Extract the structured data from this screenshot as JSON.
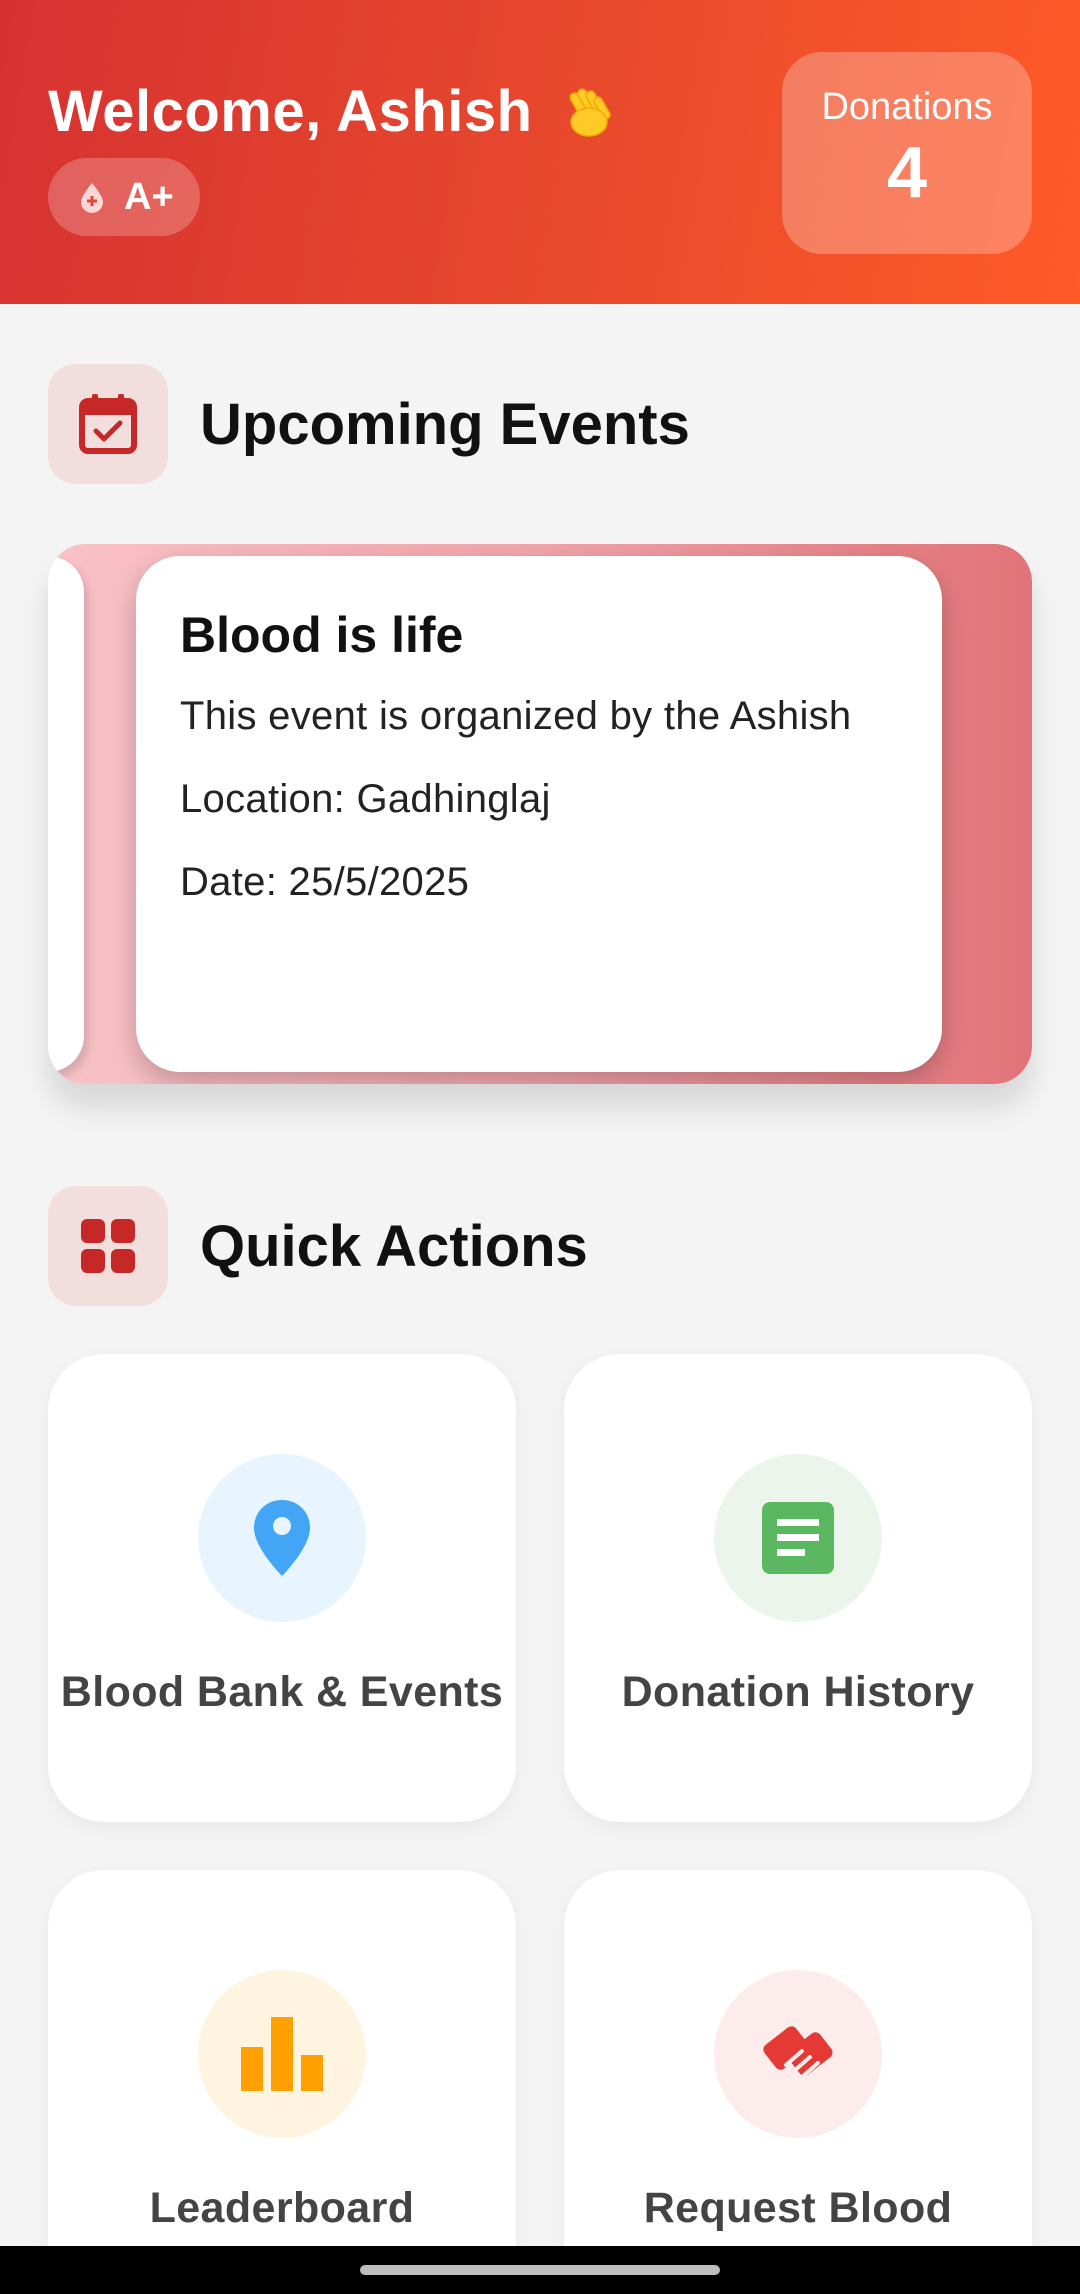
{
  "header": {
    "welcome_text": "Welcome, Ashish",
    "wave_icon": "waving-hand-icon",
    "blood_group": "A+",
    "donations_label": "Donations",
    "donations_count": "4"
  },
  "events_section": {
    "title": "Upcoming Events",
    "icon": "calendar-check-icon"
  },
  "event": {
    "title": "Blood is life",
    "description": "This event is organized by the Ashish",
    "location": "Location: Gadhinglaj",
    "date": "Date: 25/5/2025"
  },
  "actions_section": {
    "title": "Quick Actions",
    "icon": "grid-icon"
  },
  "actions": [
    {
      "label": "Blood Bank & Events",
      "icon": "location-pin-icon",
      "color": "#42a5f5",
      "bg": "#e8f4fe"
    },
    {
      "label": "Donation History",
      "icon": "document-icon",
      "color": "#5cb860",
      "bg": "#ebf5ec"
    },
    {
      "label": "Leaderboard",
      "icon": "bar-chart-icon",
      "color": "#ffa000",
      "bg": "#fff4e0"
    },
    {
      "label": "Request Blood",
      "icon": "handshake-icon",
      "color": "#e53935",
      "bg": "#fdecec"
    }
  ],
  "colors": {
    "header_start": "#d63232",
    "header_end": "#ff5a28",
    "accent": "#c62828"
  }
}
